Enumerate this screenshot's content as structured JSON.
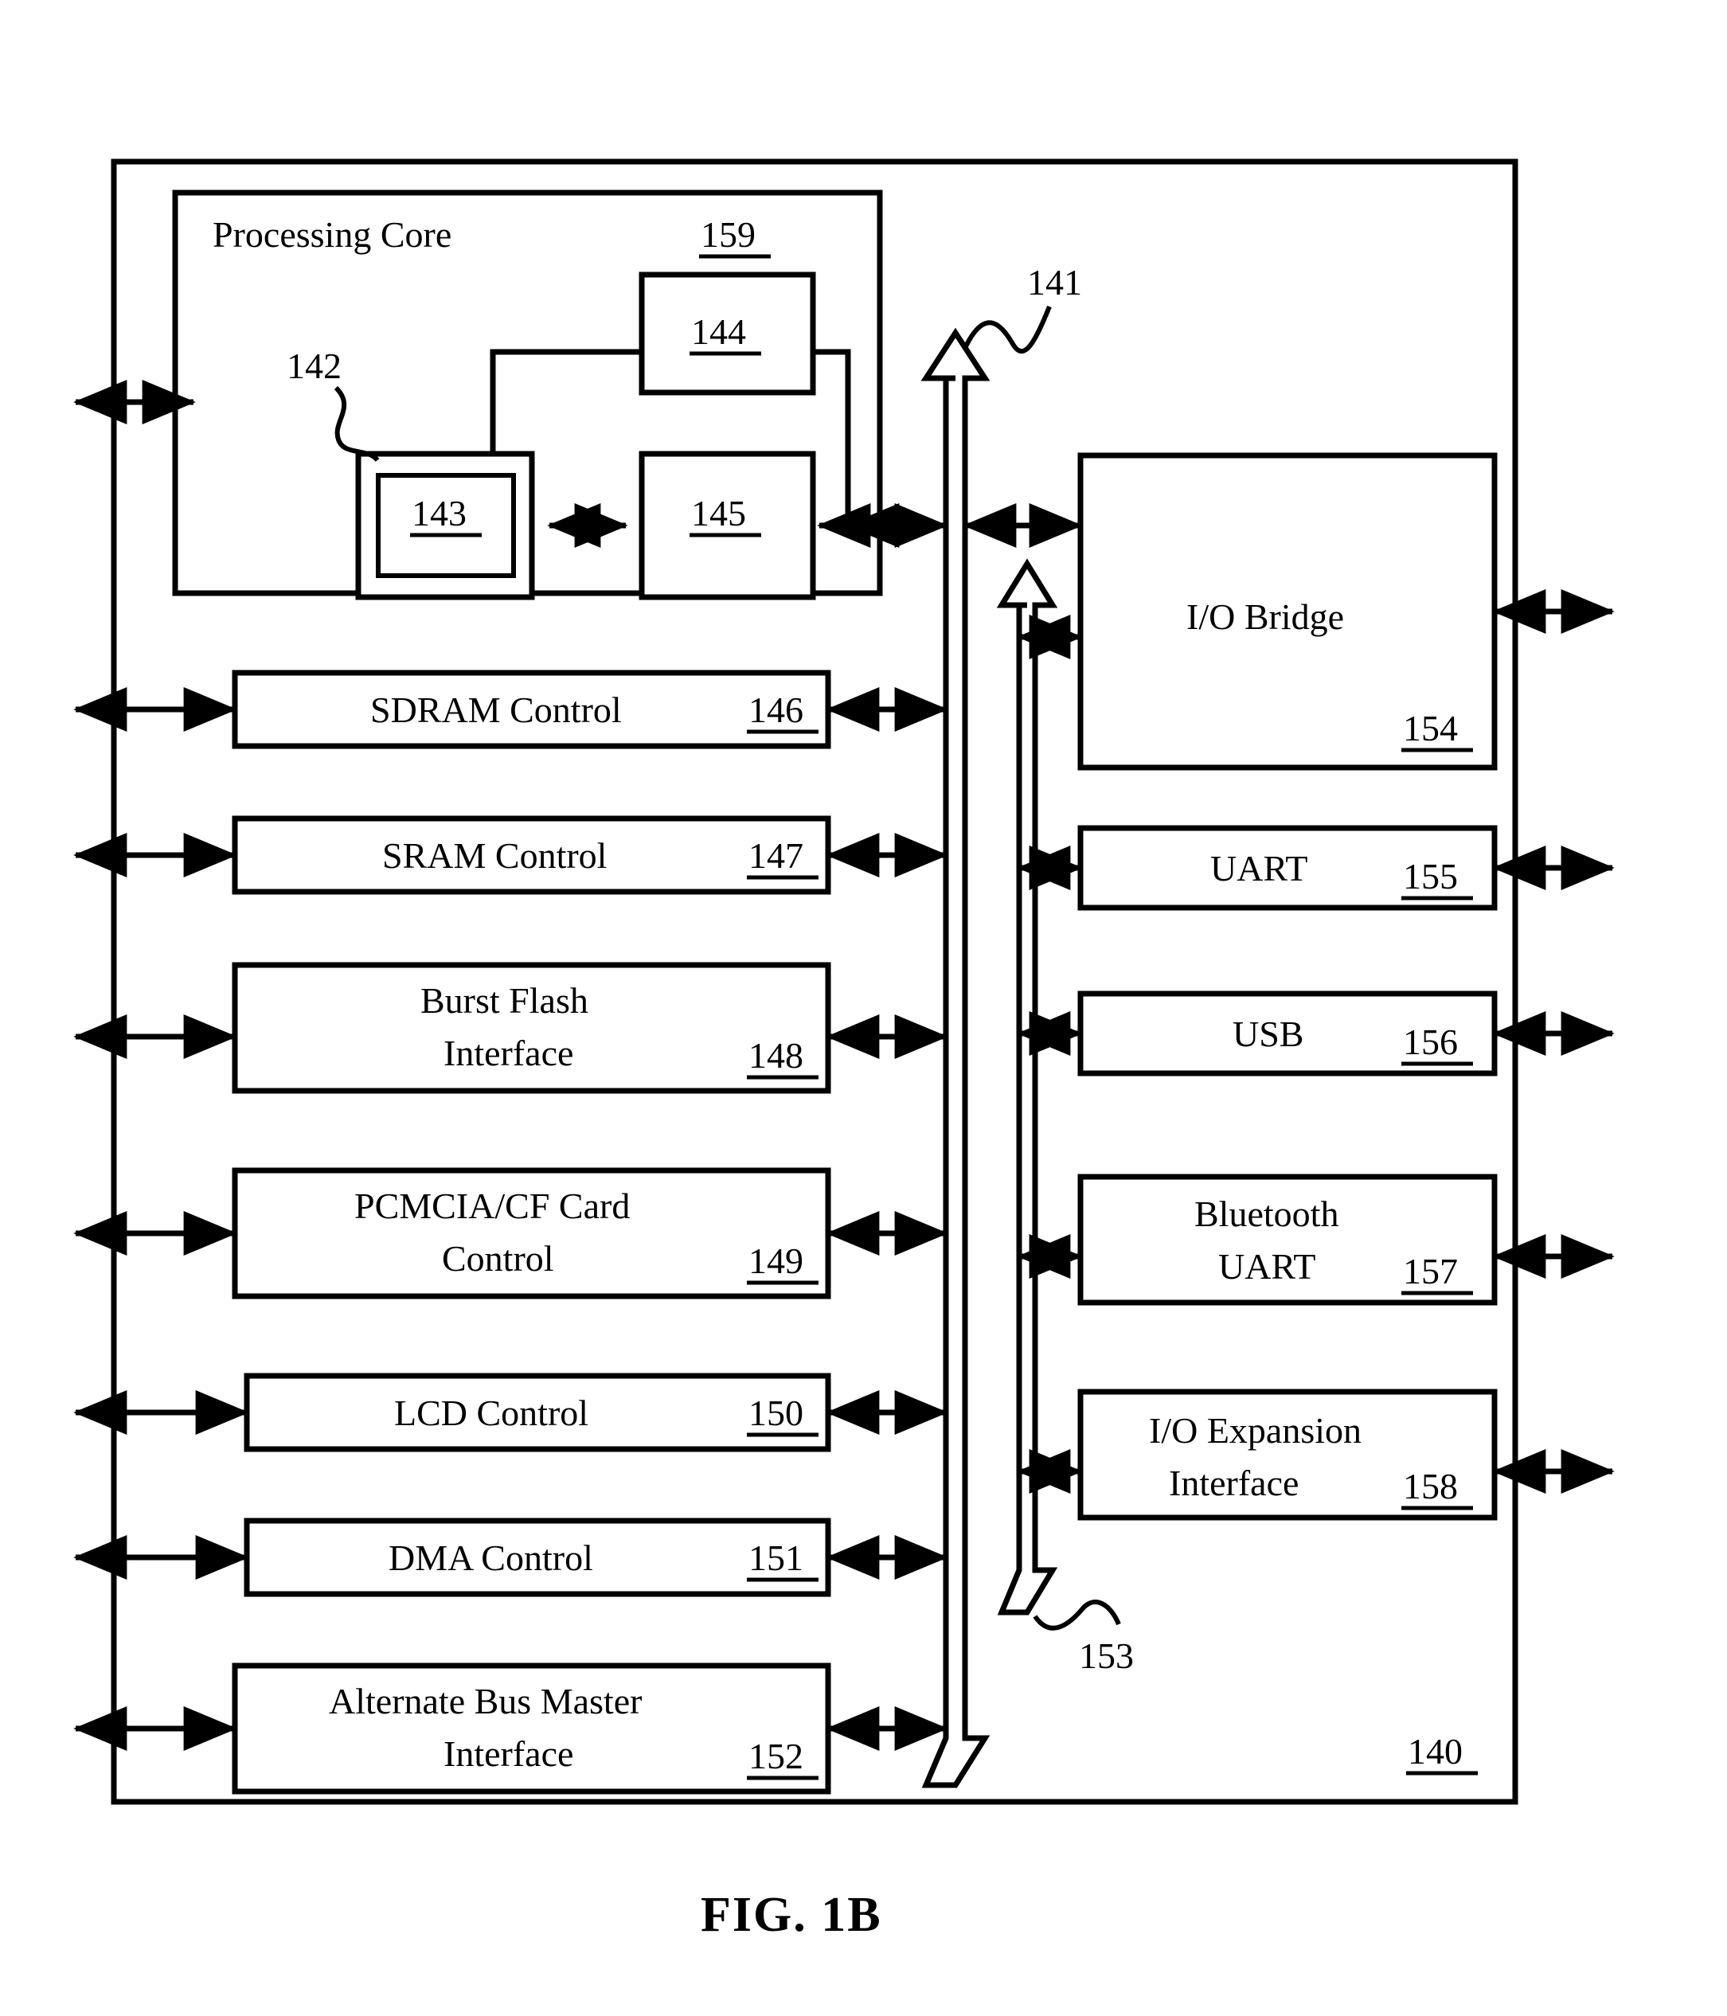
{
  "figure": {
    "caption": "FIG. 1B",
    "outer_ref": "140"
  },
  "processing_core": {
    "title": "Processing Core",
    "ref": "159",
    "pointer_ref": "142",
    "sub_blocks": [
      {
        "ref": "143",
        "name": "inner-register-block"
      },
      {
        "ref": "144",
        "name": "upper-unit-block"
      },
      {
        "ref": "145",
        "name": "lower-unit-block"
      }
    ]
  },
  "bus": {
    "main_ref": "141",
    "secondary_ref": "153"
  },
  "left_column": [
    {
      "label_line1": "SDRAM Control",
      "label_line2": "",
      "ref": "146",
      "name": "sdram-control"
    },
    {
      "label_line1": "SRAM Control",
      "label_line2": "",
      "ref": "147",
      "name": "sram-control"
    },
    {
      "label_line1": "Burst Flash",
      "label_line2": "Interface",
      "ref": "148",
      "name": "burst-flash-interface"
    },
    {
      "label_line1": "PCMCIA/CF Card",
      "label_line2": "Control",
      "ref": "149",
      "name": "pcmcia-cf-card-control"
    },
    {
      "label_line1": "LCD Control",
      "label_line2": "",
      "ref": "150",
      "name": "lcd-control"
    },
    {
      "label_line1": "DMA Control",
      "label_line2": "",
      "ref": "151",
      "name": "dma-control"
    },
    {
      "label_line1": "Alternate Bus Master",
      "label_line2": "Interface",
      "ref": "152",
      "name": "alternate-bus-master-interface"
    }
  ],
  "right_column": [
    {
      "label_line1": "I/O Bridge",
      "label_line2": "",
      "ref": "154",
      "name": "io-bridge"
    },
    {
      "label_line1": "UART",
      "label_line2": "",
      "ref": "155",
      "name": "uart"
    },
    {
      "label_line1": "USB",
      "label_line2": "",
      "ref": "156",
      "name": "usb"
    },
    {
      "label_line1": "Bluetooth",
      "label_line2": "UART",
      "ref": "157",
      "name": "bluetooth-uart"
    },
    {
      "label_line1": "I/O Expansion",
      "label_line2": "Interface",
      "ref": "158",
      "name": "io-expansion-interface"
    }
  ],
  "colors": {
    "stroke": "#000000",
    "fill": "#ffffff"
  }
}
